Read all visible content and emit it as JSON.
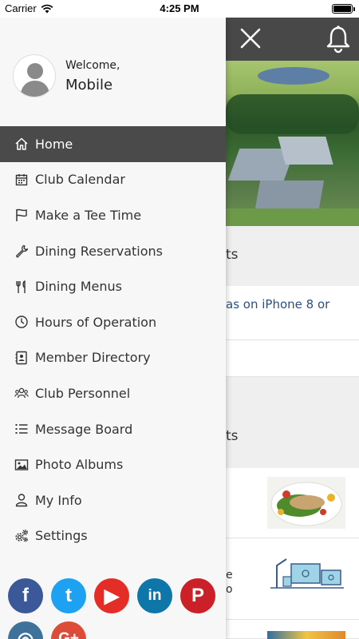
{
  "status_bar": {
    "carrier": "Carrier",
    "time": "4:25 PM"
  },
  "drawer": {
    "welcome": "Welcome,",
    "user_name": "Mobile",
    "menu": [
      {
        "label": "Home",
        "icon": "home-icon",
        "active": true
      },
      {
        "label": "Club Calendar",
        "icon": "calendar-icon"
      },
      {
        "label": "Make a Tee Time",
        "icon": "flag-icon"
      },
      {
        "label": "Dining Reservations",
        "icon": "wrench-icon"
      },
      {
        "label": "Dining Menus",
        "icon": "utensils-icon"
      },
      {
        "label": "Hours of Operation",
        "icon": "clock-icon"
      },
      {
        "label": "Member Directory",
        "icon": "address-book-icon"
      },
      {
        "label": "Club Personnel",
        "icon": "users-icon"
      },
      {
        "label": "Message Board",
        "icon": "list-icon"
      },
      {
        "label": "Photo Albums",
        "icon": "image-icon"
      },
      {
        "label": "My Info",
        "icon": "user-icon"
      },
      {
        "label": "Settings",
        "icon": "gears-icon"
      }
    ],
    "social": [
      {
        "name": "facebook-icon",
        "glyph": "f",
        "color": "#3b5998"
      },
      {
        "name": "twitter-icon",
        "glyph": "t",
        "color": "#1da1f2"
      },
      {
        "name": "youtube-icon",
        "glyph": "▶",
        "color": "#e52d27"
      },
      {
        "name": "linkedin-icon",
        "glyph": "in",
        "color": "#0e76a8"
      },
      {
        "name": "pinterest-icon",
        "glyph": "P",
        "color": "#cb2027"
      },
      {
        "name": "instagram-icon",
        "glyph": "◎",
        "color": "#3f729b"
      },
      {
        "name": "google-plus-icon",
        "glyph": "G+",
        "color": "#dd4b39"
      }
    ]
  },
  "background": {
    "section1_text": "ts",
    "link_text": "as on iPhone 8 or",
    "section2_text": "ts",
    "card2_text_a": "e",
    "card2_text_b": "o"
  },
  "colors": {
    "header": "#484848",
    "active_item": "#4a4a4a",
    "drawer_bg": "#f7f7f7"
  }
}
